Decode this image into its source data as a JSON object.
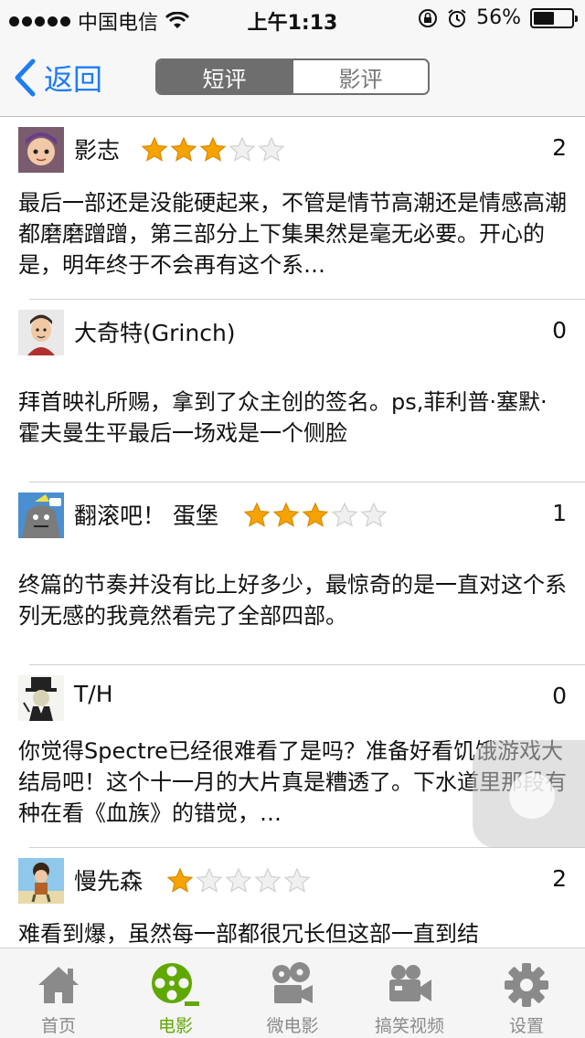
{
  "status_bar": {
    "carrier": "中国电信",
    "time": "上午1:13",
    "battery": "56%",
    "battery_level": 0.56
  },
  "nav": {
    "back_label": "返回",
    "segments": [
      "短评",
      "影评"
    ],
    "active_segment": 0
  },
  "reviews": [
    {
      "user": "影志",
      "rating": 3,
      "count": "2",
      "text": "最后一部还是没能硬起来，不管是情节高潮还是情感高潮都磨磨蹭蹭，第三部分上下集果然是毫无必要。开心的是，明年终于不会再有这个系…"
    },
    {
      "user": "大奇特(Grinch)",
      "rating": 0,
      "count": "0",
      "text": "拜首映礼所赐，拿到了众主创的签名。ps,菲利普·塞默·霍夫曼生平最后一场戏是一个侧脸"
    },
    {
      "user": "翻滚吧！ 蛋堡",
      "rating": 3,
      "count": "1",
      "text": "终篇的节奏并没有比上好多少，最惊奇的是一直对这个系列无感的我竟然看完了全部四部。"
    },
    {
      "user": "T/H",
      "rating": 0,
      "count": "0",
      "text": "你觉得Spectre已经很难看了是吗？准备好看饥饿游戏大结局吧！这个十一月的大片真是糟透了。下水道里那段有种在看《血族》的错觉，…"
    },
    {
      "user": "慢先森",
      "rating": 1,
      "count": "2",
      "text": "难看到爆，虽然每一部都很冗长但这部一直到结"
    }
  ],
  "tabs": [
    {
      "label": "首页",
      "icon": "home-icon"
    },
    {
      "label": "电影",
      "icon": "film-reel-icon"
    },
    {
      "label": "微电影",
      "icon": "movie-camera-icon"
    },
    {
      "label": "搞笑视频",
      "icon": "video-camera-icon"
    },
    {
      "label": "设置",
      "icon": "gear-icon"
    }
  ],
  "active_tab": 1,
  "colors": {
    "accent": "#1e7cf2",
    "star": "#f5a300",
    "tab_active": "#5fa800",
    "tab_inactive": "#8a8a8a"
  }
}
